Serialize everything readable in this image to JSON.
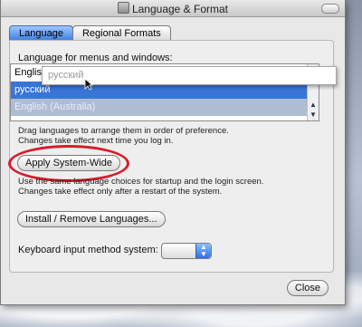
{
  "window": {
    "title": "Language & Format"
  },
  "tabs": [
    {
      "label": "Language"
    },
    {
      "label": "Regional Formats"
    }
  ],
  "language_section": {
    "header": "Language for menus and windows:",
    "list_items": [
      {
        "label": "English"
      },
      {
        "label": "русский"
      },
      {
        "label": "English (Australia)"
      }
    ],
    "dragged_item": "русский",
    "drag_note_line1": "Drag languages to arrange them in order of preference.",
    "drag_note_line2": "Changes take effect next time you log in."
  },
  "apply_button": {
    "label": "Apply System-Wide"
  },
  "apply_note": {
    "line1": "Use the same language choices for startup and the login screen.",
    "line2": "Changes take effect only after a restart of the system."
  },
  "install_button": {
    "label": "Install / Remove Languages..."
  },
  "keyboard": {
    "label": "Keyboard input method system:",
    "selected_value": ""
  },
  "close_button": {
    "label": "Close"
  },
  "colors": {
    "selection_blue": "#3875d7",
    "annotation_red": "#d81c2a",
    "tab_active": "#3b7ce6"
  }
}
